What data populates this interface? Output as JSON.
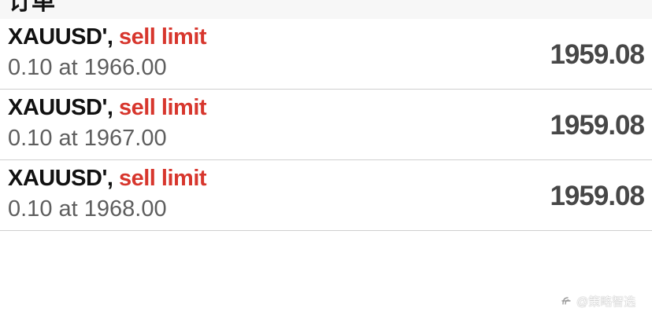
{
  "header": {
    "title": "订单"
  },
  "orders": [
    {
      "symbol": "XAUUSD'",
      "separator": ",",
      "type": "sell limit",
      "details": "0.10 at 1966.00",
      "current_price": "1959.08"
    },
    {
      "symbol": "XAUUSD'",
      "separator": ",",
      "type": "sell limit",
      "details": "0.10 at 1967.00",
      "current_price": "1959.08"
    },
    {
      "symbol": "XAUUSD'",
      "separator": ",",
      "type": "sell limit",
      "details": "0.10 at 1968.00",
      "current_price": "1959.08"
    }
  ],
  "colors": {
    "sell": "#d7362d",
    "symbol": "#111111",
    "details": "#5e5e5e",
    "price": "#474747"
  },
  "watermark": {
    "icon": "platform-logo-icon",
    "text": "@策略智选"
  }
}
